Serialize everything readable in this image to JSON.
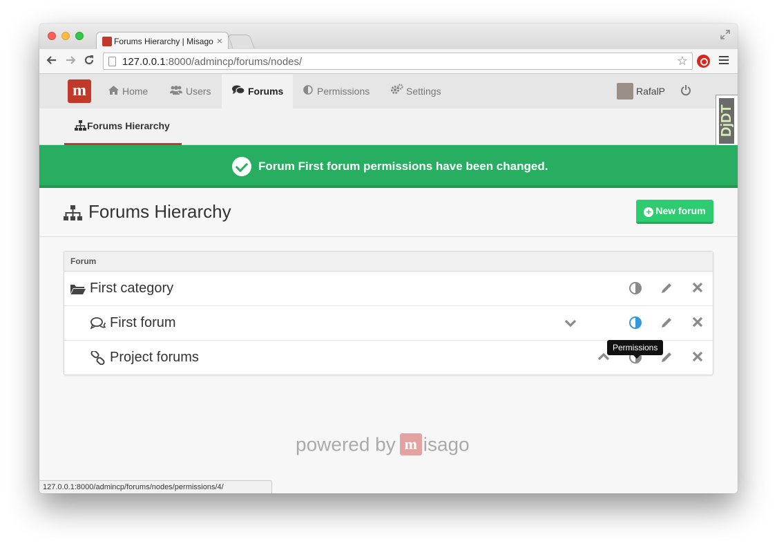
{
  "browser": {
    "tab_title": "Forums Hierarchy | Misago",
    "tab_close": "×",
    "url_host": "127.0.0.1",
    "url_rest": ":8000/admincp/forums/nodes/",
    "status_url": "127.0.0.1:8000/admincp/forums/nodes/permissions/4/"
  },
  "nav": {
    "logo_letter": "m",
    "items": [
      {
        "label": "Home",
        "icon": "home-icon"
      },
      {
        "label": "Users",
        "icon": "users-icon"
      },
      {
        "label": "Forums",
        "icon": "comments-icon",
        "active": true
      },
      {
        "label": "Permissions",
        "icon": "adjust-icon"
      },
      {
        "label": "Settings",
        "icon": "cogs-icon"
      }
    ],
    "username": "RafalP"
  },
  "subnav": {
    "item": "Forums Hierarchy"
  },
  "debug_toolbar": "DjDT",
  "flash": {
    "message": "Forum First forum permissions have been changed.",
    "color": "#27ae60"
  },
  "header": {
    "title": "Forums Hierarchy",
    "new_button": "New forum"
  },
  "table": {
    "column": "Forum",
    "rows": [
      {
        "name": "First category",
        "icon": "folder-open-icon"
      },
      {
        "name": "First forum",
        "icon": "comments-icon"
      },
      {
        "name": "Project forums",
        "icon": "link-icon"
      }
    ]
  },
  "tooltip": "Permissions",
  "footer": {
    "powered_by": "powered by",
    "brand": "isago"
  }
}
